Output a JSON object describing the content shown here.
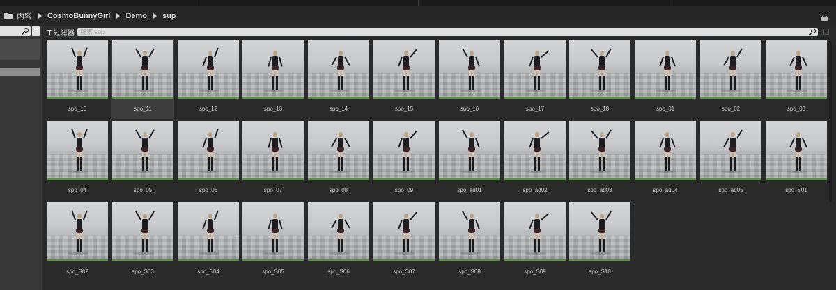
{
  "breadcrumb": {
    "root": "内容",
    "items": [
      "CosmoBunnyGirl",
      "Demo",
      "sup"
    ]
  },
  "filter": {
    "label": "过滤器",
    "search_placeholder": "搜索 sup"
  },
  "selected_asset": "spo_11",
  "assets": [
    "spo_10",
    "spo_11",
    "spo_12",
    "spo_13",
    "spo_14",
    "spo_15",
    "spo_16",
    "spo_17",
    "spo_18",
    "spo_01",
    "spo_02",
    "spo_03",
    "spo_04",
    "spo_05",
    "spo_06",
    "spo_07",
    "spo_08",
    "spo_09",
    "spo_ad01",
    "spo_ad02",
    "spo_ad03",
    "spo_ad04",
    "spo_ad05",
    "spo_S01",
    "spo_S02",
    "spo_S03",
    "spo_S04",
    "spo_S05",
    "spo_S06",
    "spo_S07",
    "spo_S08",
    "spo_S09",
    "spo_S10"
  ],
  "colors": {
    "panel": "#2a2a2a",
    "ground": "#5d8f4a",
    "selected_tile": "#3d3d3d"
  },
  "icons": [
    "folder-icon",
    "chevron-right-icon",
    "lock-icon",
    "search-icon",
    "view-options-icon",
    "funnel-icon",
    "dropdown-arrow-icon"
  ]
}
